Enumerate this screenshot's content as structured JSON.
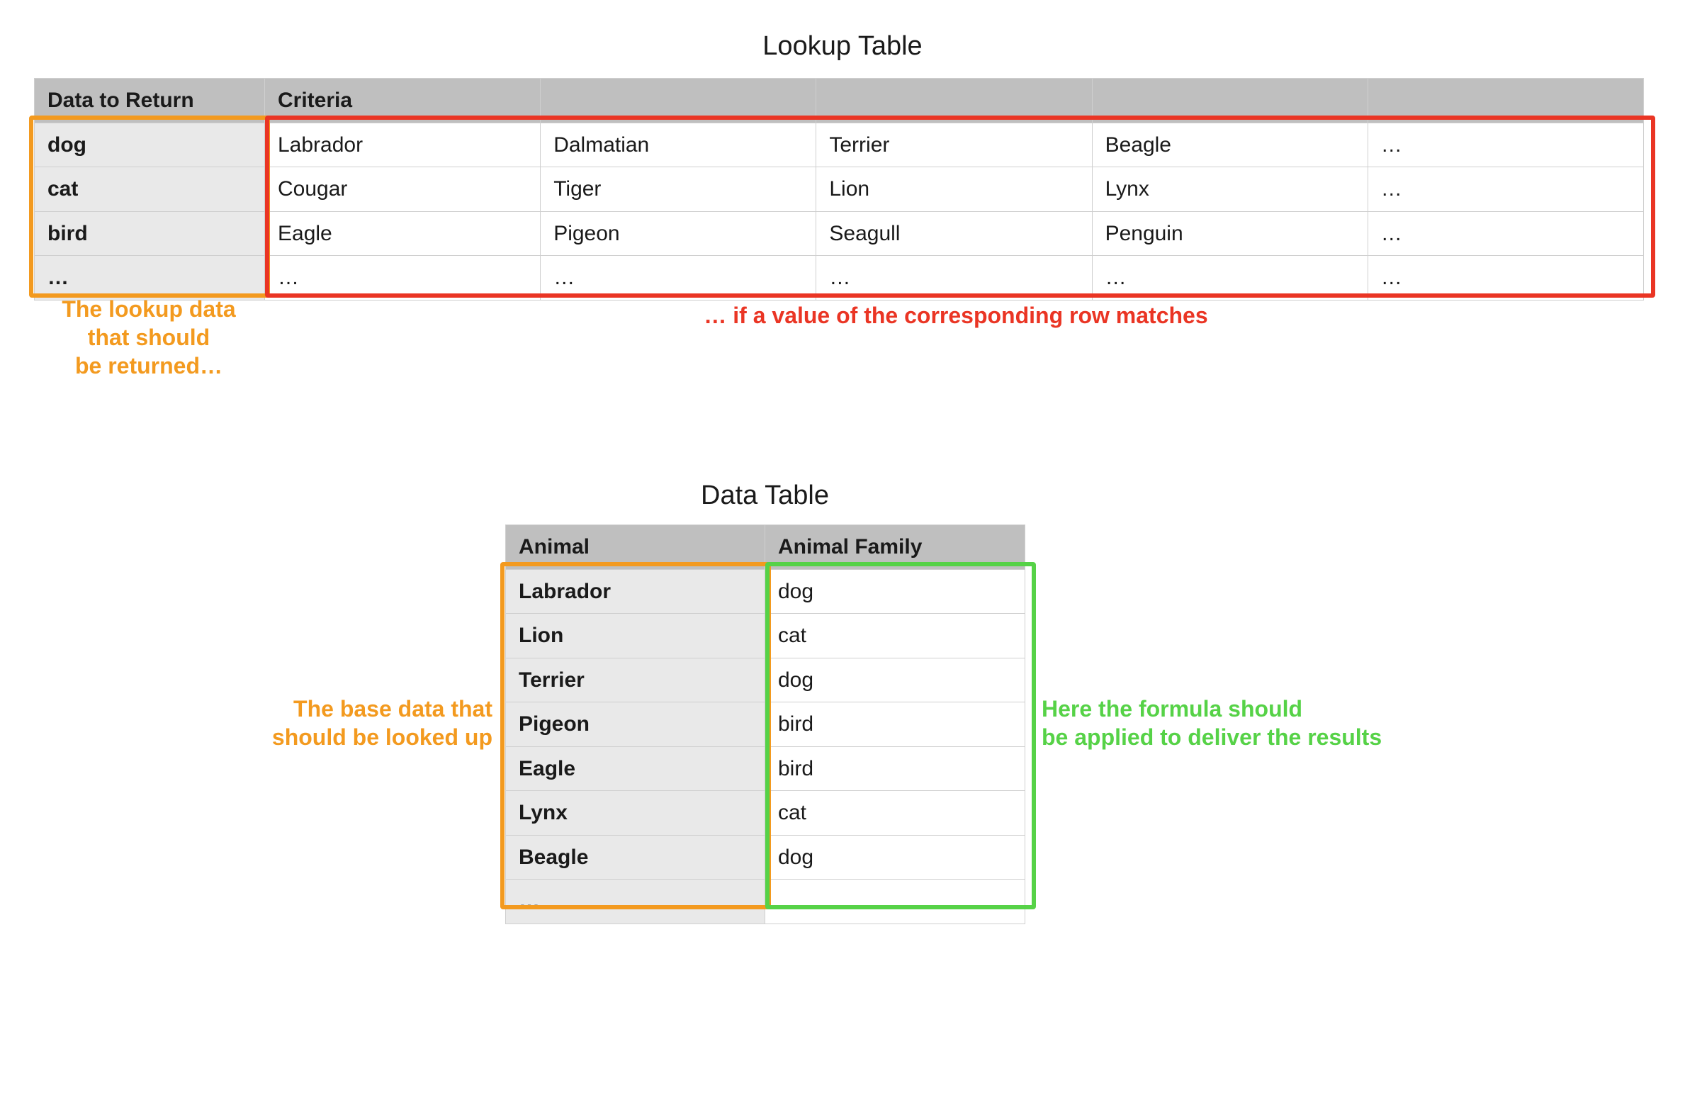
{
  "titles": {
    "lookup": "Lookup Table",
    "data": "Data Table"
  },
  "lookup_table": {
    "headers": [
      "Data to Return",
      "Criteria",
      "",
      "",
      "",
      ""
    ],
    "rows": [
      [
        "dog",
        "Labrador",
        "Dalmatian",
        "Terrier",
        "Beagle",
        "…"
      ],
      [
        "cat",
        "Cougar",
        "Tiger",
        "Lion",
        "Lynx",
        "…"
      ],
      [
        "bird",
        "Eagle",
        "Pigeon",
        "Seagull",
        "Penguin",
        "…"
      ],
      [
        "…",
        "…",
        "…",
        "…",
        "…",
        "…"
      ]
    ]
  },
  "data_table": {
    "headers": [
      "Animal",
      "Animal Family"
    ],
    "rows": [
      [
        "Labrador",
        "dog"
      ],
      [
        "Lion",
        "cat"
      ],
      [
        "Terrier",
        "dog"
      ],
      [
        "Pigeon",
        "bird"
      ],
      [
        "Eagle",
        "bird"
      ],
      [
        "Lynx",
        "cat"
      ],
      [
        "Beagle",
        "dog"
      ],
      [
        "…",
        "…"
      ]
    ]
  },
  "captions": {
    "orange_lookup": "The lookup data\nthat should\nbe returned…",
    "red_lookup": "… if a value of the corresponding row matches",
    "orange_data": "The base data that\nshould be looked up",
    "green_data": "Here the formula should\nbe applied to deliver the results"
  },
  "colors": {
    "orange": "#f39a1f",
    "red": "#ea3524",
    "green": "#56d247",
    "header_bg": "#bfbfbf",
    "rowhdr_bg": "#e9e9e9",
    "cell_border": "#cfcfcf"
  }
}
